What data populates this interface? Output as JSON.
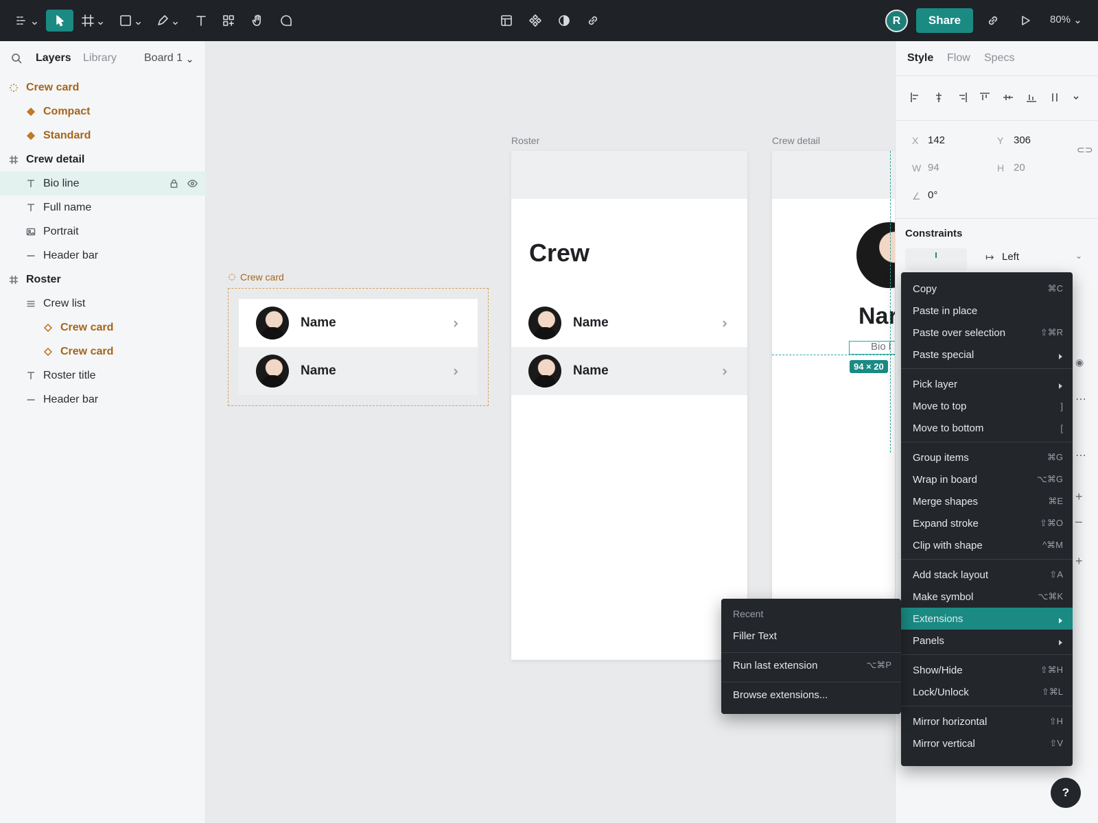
{
  "toolbar": {
    "share_label": "Share",
    "avatar_initial": "R",
    "zoom": "80%"
  },
  "left": {
    "tabs": {
      "layers": "Layers",
      "library": "Library"
    },
    "board": "Board 1",
    "layers": [
      {
        "label": "Crew card",
        "kind": "component"
      },
      {
        "label": "Compact",
        "kind": "variant"
      },
      {
        "label": "Standard",
        "kind": "variant"
      },
      {
        "label": "Crew detail",
        "kind": "frame"
      },
      {
        "label": "Bio line",
        "kind": "text"
      },
      {
        "label": "Full name",
        "kind": "text"
      },
      {
        "label": "Portrait",
        "kind": "image"
      },
      {
        "label": "Header bar",
        "kind": "line"
      },
      {
        "label": "Roster",
        "kind": "frame"
      },
      {
        "label": "Crew list",
        "kind": "list"
      },
      {
        "label": "Crew card",
        "kind": "instance"
      },
      {
        "label": "Crew card",
        "kind": "instance"
      },
      {
        "label": "Roster title",
        "kind": "text"
      },
      {
        "label": "Header bar",
        "kind": "line"
      }
    ]
  },
  "canvas": {
    "comp_label": "Crew card",
    "roster_label": "Roster",
    "detail_label": "Crew detail",
    "roster_title": "Crew",
    "card_name": "Name",
    "detail_name": "Nar",
    "bio_text": "Bio l",
    "dim_tag": "94 × 20"
  },
  "right": {
    "tabs": {
      "style": "Style",
      "flow": "Flow",
      "specs": "Specs"
    },
    "x_label": "X",
    "x": "142",
    "y_label": "Y",
    "y": "306",
    "w_label": "W",
    "w": "94",
    "h_label": "H",
    "h": "20",
    "rotation": "0°",
    "constraints_title": "Constraints",
    "constraint_value": "Left"
  },
  "context_menu": [
    {
      "label": "Copy",
      "shortcut": "⌘C"
    },
    {
      "label": "Paste in place",
      "shortcut": ""
    },
    {
      "label": "Paste over selection",
      "shortcut": "⇧⌘R"
    },
    {
      "label": "Paste special",
      "shortcut": "",
      "submenu": true
    },
    {
      "label": "Pick layer",
      "shortcut": "",
      "submenu": true
    },
    {
      "label": "Move to top",
      "shortcut": "]"
    },
    {
      "label": "Move to bottom",
      "shortcut": "["
    },
    {
      "label": "Group items",
      "shortcut": "⌘G"
    },
    {
      "label": "Wrap in board",
      "shortcut": "⌥⌘G"
    },
    {
      "label": "Merge shapes",
      "shortcut": "⌘E"
    },
    {
      "label": "Expand stroke",
      "shortcut": "⇧⌘O"
    },
    {
      "label": "Clip with shape",
      "shortcut": "^⌘M"
    },
    {
      "label": "Add stack layout",
      "shortcut": "⇧A"
    },
    {
      "label": "Make symbol",
      "shortcut": "⌥⌘K"
    },
    {
      "label": "Extensions",
      "shortcut": "",
      "submenu": true,
      "highlighted": true
    },
    {
      "label": "Panels",
      "shortcut": "",
      "submenu": true
    },
    {
      "label": "Show/Hide",
      "shortcut": "⇧⌘H"
    },
    {
      "label": "Lock/Unlock",
      "shortcut": "⇧⌘L"
    },
    {
      "label": "Mirror horizontal",
      "shortcut": "⇧H"
    },
    {
      "label": "Mirror vertical",
      "shortcut": "⇧V"
    }
  ],
  "submenu": {
    "header": "Recent",
    "items": [
      {
        "label": "Filler Text",
        "shortcut": ""
      },
      {
        "label": "Run last extension",
        "shortcut": "⌥⌘P"
      },
      {
        "label": "Browse extensions...",
        "shortcut": ""
      }
    ]
  },
  "help_label": "?",
  "colors": {
    "accent": "#1a8a83",
    "component": "#a5651b",
    "toolbar_bg": "#1f2227"
  }
}
